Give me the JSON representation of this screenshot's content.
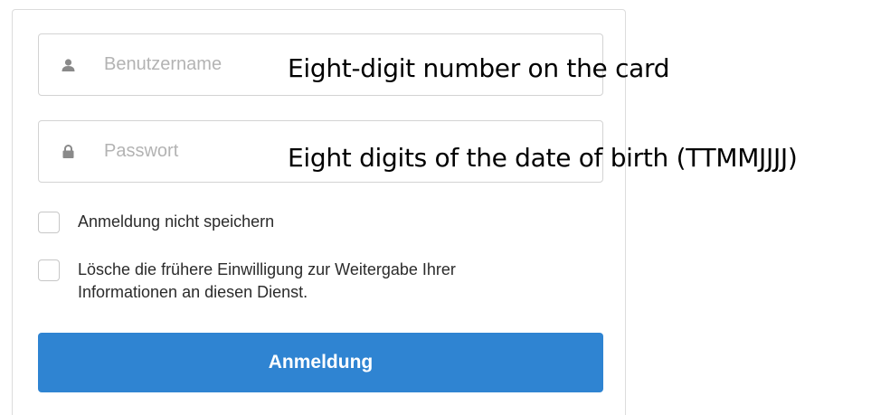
{
  "form": {
    "username": {
      "placeholder": "Benutzername",
      "value": "",
      "icon": "user-icon"
    },
    "password": {
      "placeholder": "Passwort",
      "value": "",
      "icon": "lock-icon"
    },
    "checkboxes": [
      {
        "label_lines": [
          "Anmeldung nicht speichern"
        ],
        "checked": false
      },
      {
        "label_lines": [
          "Lösche die frühere Einwilligung zur Weitergabe Ihrer",
          "Informationen an diesen Dienst."
        ],
        "checked": false
      }
    ],
    "submit_label": "Anmeldung"
  },
  "annotations": {
    "username_hint": "Eight-digit number on the card",
    "password_hint": "Eight digits of the date of birth (TTMMJJJJ)"
  },
  "colors": {
    "button_bg": "#2f84d2",
    "button_text": "#ffffff",
    "placeholder": "#b3b3b3",
    "icon": "#8a8a8a",
    "border": "#d3d3d3"
  }
}
